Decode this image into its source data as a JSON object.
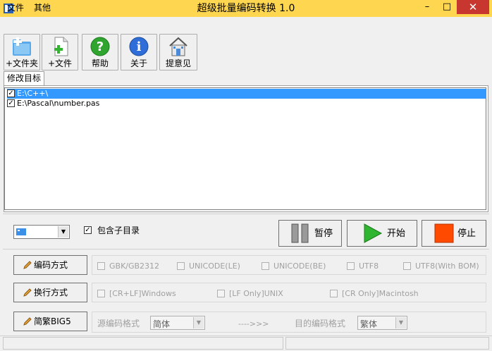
{
  "window": {
    "title": "超级批量编码转换 1.0",
    "minimize_label": "–",
    "maximize_label": "□",
    "close_label": "✕"
  },
  "menu": [
    "文件",
    "其他"
  ],
  "toolbar": {
    "add_folder": "+文件夹",
    "add_file": "+文件",
    "help": "帮助",
    "about": "关于",
    "feedback": "提意见"
  },
  "tab_label": "修改目标",
  "targets": [
    {
      "path": "E:\\C++\\",
      "checked": true,
      "selected": true
    },
    {
      "path": "E:\\Pascal\\number.pas",
      "checked": true,
      "selected": false
    }
  ],
  "controls": {
    "include_subdirs": "包含子目录",
    "pause": "暂停",
    "start": "开始",
    "stop": "停止"
  },
  "encoding_row": {
    "button": "编码方式",
    "options": [
      "GBK/GB2312",
      "UNICODE(LE)",
      "UNICODE(BE)",
      "UTF8",
      "UTF8(With BOM)"
    ]
  },
  "linebreak_row": {
    "button": "换行方式",
    "options": [
      "[CR+LF]Windows",
      "[LF Only]UNIX",
      "[CR Only]Macintosh"
    ]
  },
  "big5_row": {
    "button": "简繁BIG5",
    "source_label": "源编码格式",
    "source_value": "简体",
    "arrow": "---->>>",
    "target_label": "目的编码格式",
    "target_value": "繁体"
  },
  "colors": {
    "titlebar": "#ffd64f",
    "close": "#c7372f",
    "selection": "#3399ff",
    "start_green": "#2fb52f",
    "stop_orange": "#ff4a00"
  }
}
